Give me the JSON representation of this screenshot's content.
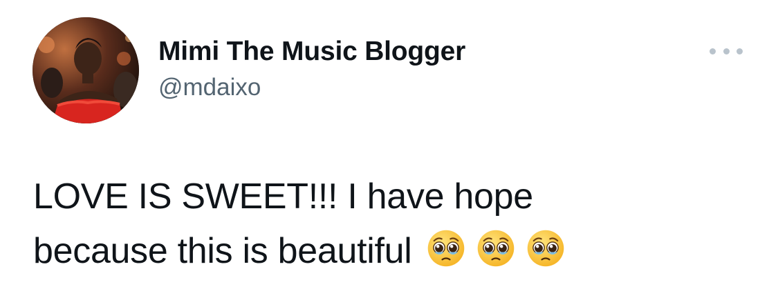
{
  "tweet": {
    "author": {
      "display_name": "Mimi The Music Blogger",
      "handle": "@mdaixo",
      "avatar_icon": "profile-photo"
    },
    "more_icon": "ellipsis-icon",
    "text_line1": "LOVE IS SWEET!!! I have hope",
    "text_line2": "because this is beautiful",
    "emojis": [
      "pleading-face-emoji",
      "pleading-face-emoji",
      "pleading-face-emoji"
    ]
  },
  "colors": {
    "text_primary": "#0f1419",
    "text_secondary": "#536471",
    "more_dots": "#b9c3cc",
    "background": "#ffffff"
  }
}
